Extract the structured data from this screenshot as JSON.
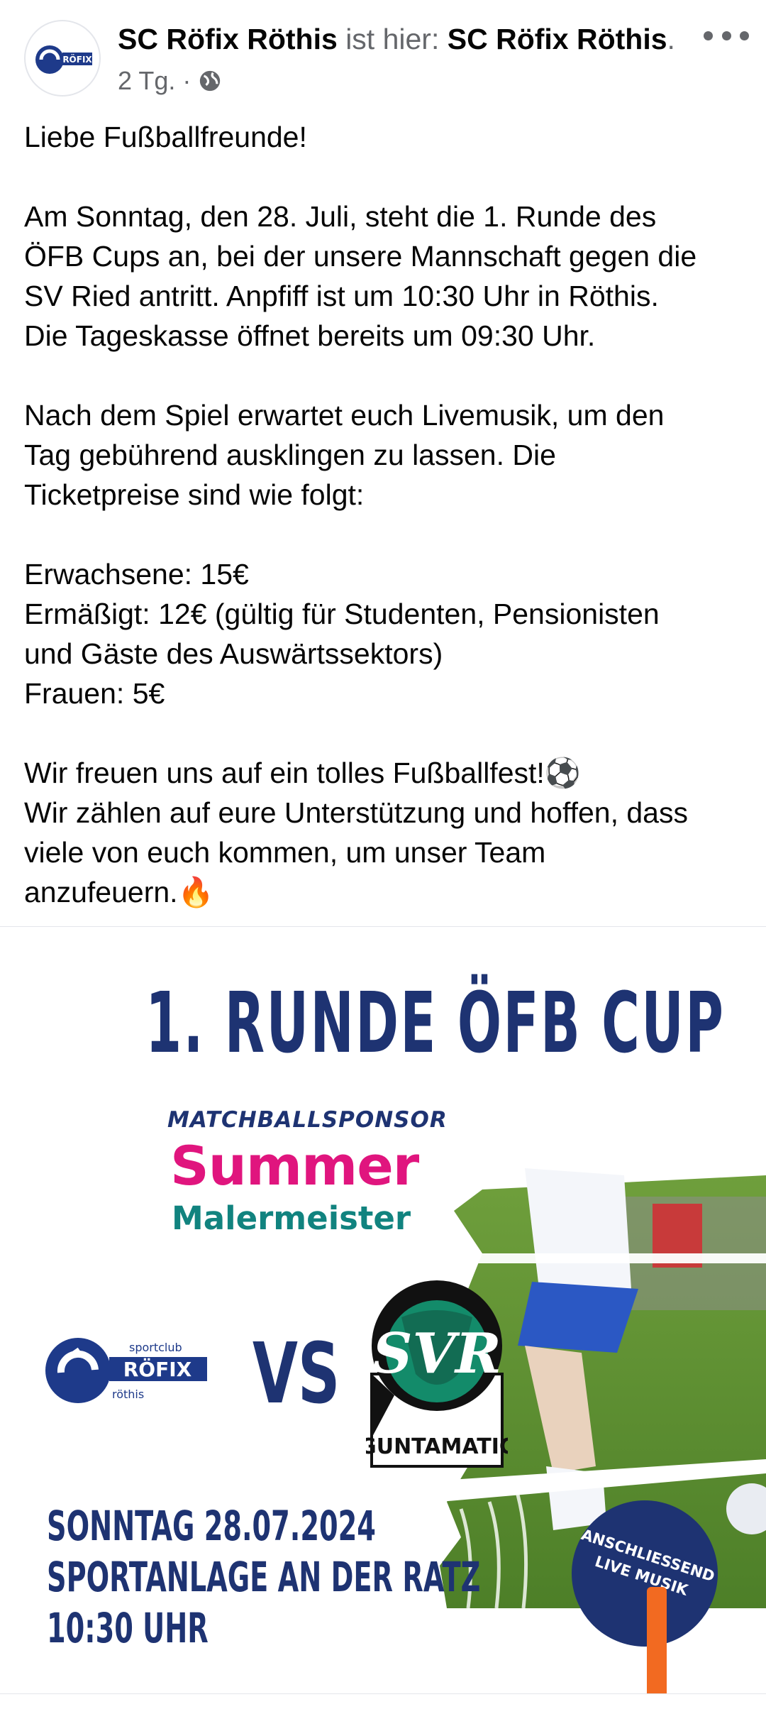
{
  "post": {
    "author": "SC Röfix Röthis",
    "location_prefix": " ist hier: ",
    "location": "SC Röfix Röthis",
    "location_suffix": ".",
    "time": "2 Tg. ·",
    "privacy_icon": "globe-icon",
    "more_icon": "more-dots-icon"
  },
  "text": {
    "p1": [
      "Liebe Fußballfreunde!"
    ],
    "p2": [
      "Am Sonntag, den 28. Juli, steht die 1. Runde des",
      "ÖFB Cups an, bei der unsere Mannschaft gegen die",
      "SV Ried antritt. Anpfiff ist um 10:30 Uhr in Röthis.",
      "Die Tageskasse öffnet bereits um 09:30 Uhr."
    ],
    "p3": [
      "Nach dem Spiel erwartet euch Livemusik, um den",
      "Tag gebührend ausklingen zu lassen. Die",
      "Ticketpreise sind wie folgt:"
    ],
    "p4": [
      "Erwachsene: 15€",
      "Ermäßigt: 12€ (gültig für Studenten, Pensionisten",
      "und Gäste des Auswärtssektors)",
      "Frauen: 5€"
    ],
    "p5": [
      "Wir freuen uns auf ein tolles Fußballfest!⚽",
      "Wir zählen auf eure Unterstützung und hoffen, dass",
      "viele von euch kommen, um unser Team",
      "anzufeuern.🔥"
    ]
  },
  "poster": {
    "title": "1. RUNDE ÖFB CUP",
    "sponsor_label": "MATCHBALLSPONSOR",
    "sponsor_name_1": "Summer",
    "sponsor_name_2": "Malermeister",
    "home_logo": {
      "small": "sportclub",
      "big": "RÖFIX",
      "town": "röthis"
    },
    "vs": "VS",
    "away_logo": {
      "monogram": "SVR",
      "sponsor": "GUNTAMATIC"
    },
    "info": [
      "SONNTAG 28.07.2024",
      "SPORTANLAGE AN DER RATZ",
      "10:30 UHR"
    ],
    "badge": [
      "ANSCHLIESSEND",
      "LIVE MUSIK"
    ],
    "colors": {
      "navy": "#1e3372",
      "pink": "#e0157e",
      "teal": "#11837f",
      "orange": "#f26a21"
    }
  }
}
